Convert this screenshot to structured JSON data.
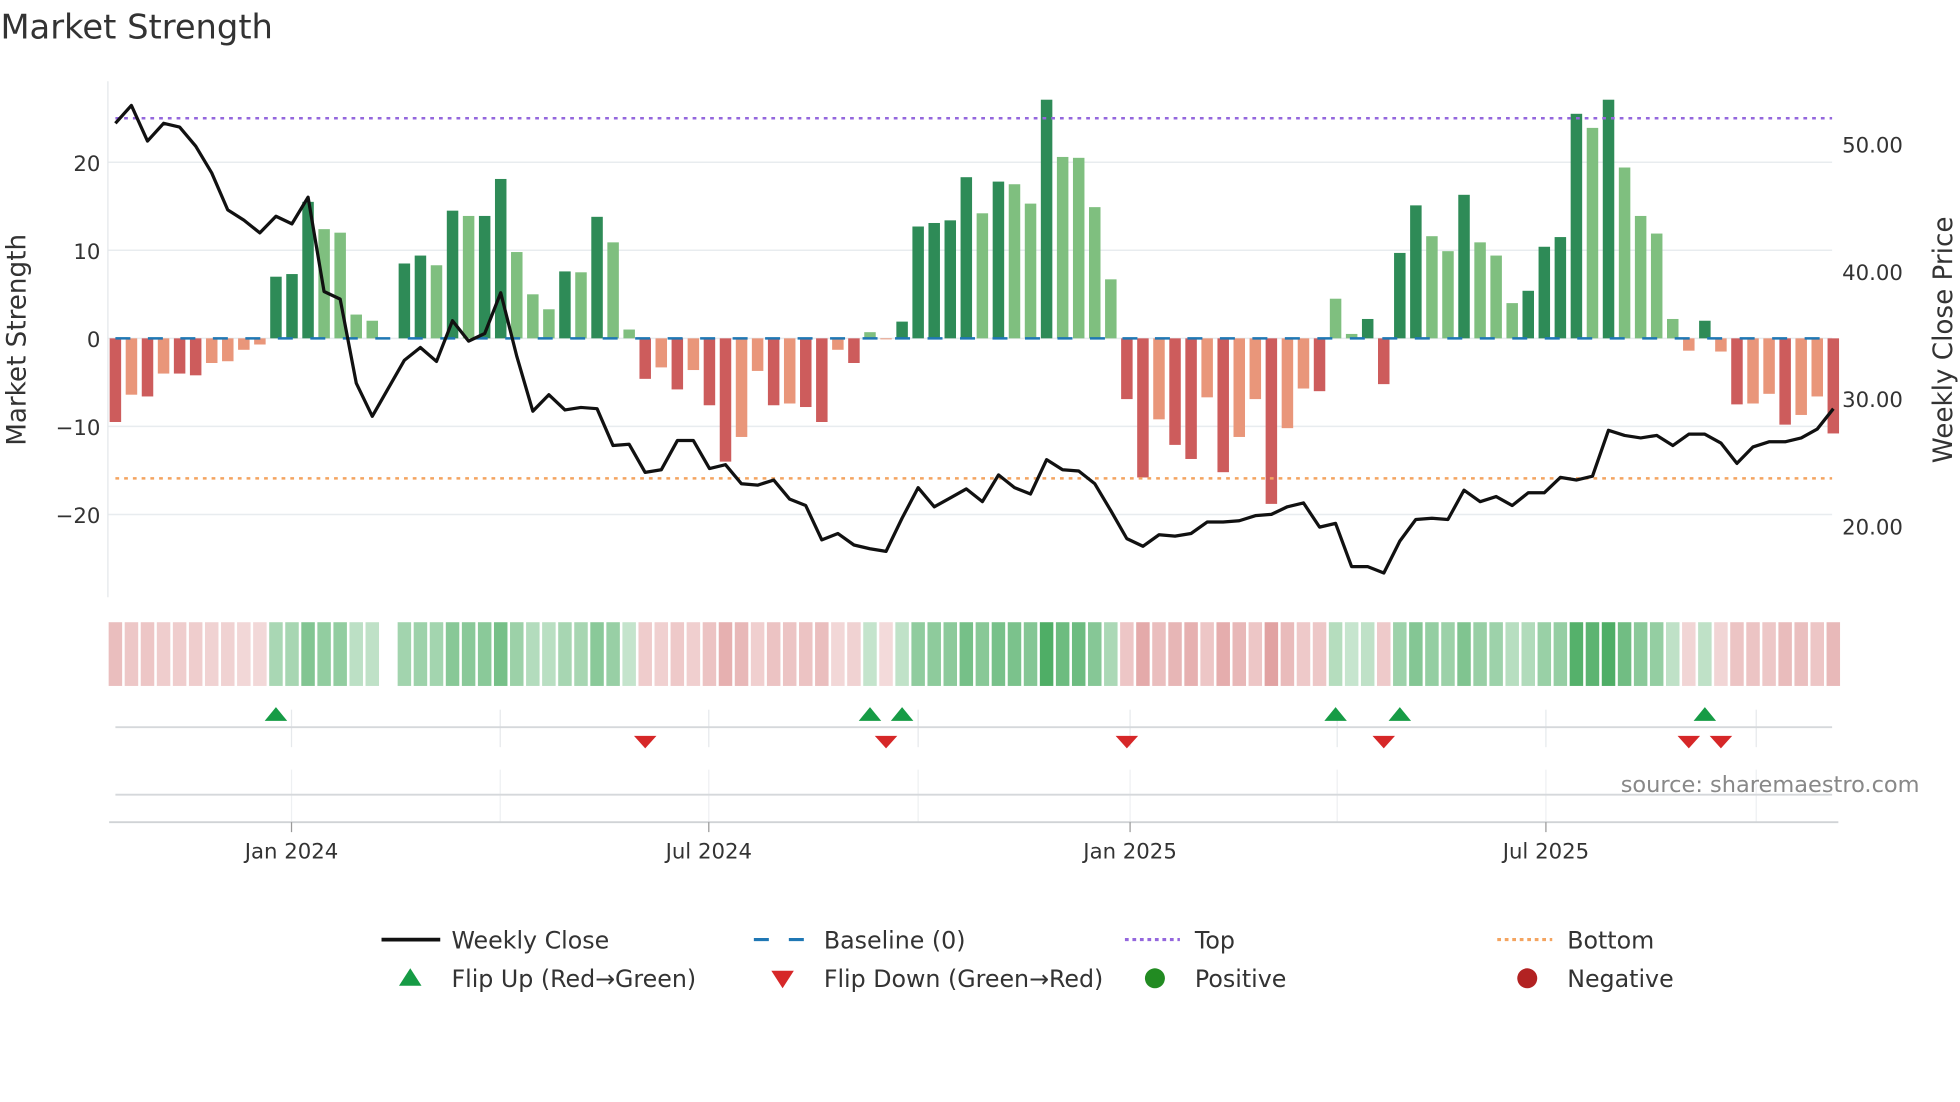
{
  "title": "Market Strength",
  "source": "source: sharemaestro.com",
  "colors": {
    "pos_strong": "#2e8b57",
    "pos_weak": "#7fbf7f",
    "neg_strong": "#cd5c5c",
    "neg_weak": "#e9967a",
    "close": "#111111",
    "baseline": "#1f77b4",
    "top": "#9467dd",
    "bottom": "#f4a460",
    "flip_up": "#169b45",
    "flip_down": "#d62728",
    "positive": "#228b22",
    "negative": "#b22222"
  },
  "chart_data": {
    "type": "bar",
    "title": "Market Strength",
    "ylabel": "Market Strength",
    "y2label": "Weekly Close Price",
    "ylim": [
      -29.4,
      29.2
    ],
    "y2lim": [
      14.4,
      54.9
    ],
    "yticks": [
      {
        "v": 20,
        "label": "20"
      },
      {
        "v": 10,
        "label": "10"
      },
      {
        "v": 0,
        "label": "0"
      },
      {
        "v": -10,
        "label": "−10"
      },
      {
        "v": -20,
        "label": "−20"
      }
    ],
    "y2ticks": [
      {
        "v": 50,
        "label": "50.00"
      },
      {
        "v": 40,
        "label": "40.00"
      },
      {
        "v": 30,
        "label": "30.00"
      },
      {
        "v": 20,
        "label": "20.00"
      }
    ],
    "xticks": [
      {
        "week": 10.97,
        "label": "Jan 2024"
      },
      {
        "week": 36.96,
        "label": "Jul 2024"
      },
      {
        "week": 63.2,
        "label": "Jan 2025"
      },
      {
        "week": 89.1,
        "label": "Jul 2025"
      }
    ],
    "quarter_grid_weeks": [
      10.97,
      23.97,
      36.96,
      50.0,
      63.2,
      76.1,
      89.1,
      102.2
    ],
    "top_level": 25.0,
    "bottom_level": -15.9,
    "strength": [
      -9.5,
      -6.4,
      -6.6,
      -4.0,
      -4.0,
      -4.2,
      -2.8,
      -2.6,
      -1.3,
      -0.7,
      7.0,
      7.3,
      15.5,
      12.4,
      12.0,
      2.7,
      2.0,
      null,
      8.5,
      9.4,
      8.3,
      14.5,
      13.9,
      13.9,
      18.1,
      9.8,
      5.0,
      3.3,
      7.6,
      7.5,
      13.8,
      10.9,
      1.0,
      -4.6,
      -3.3,
      -5.8,
      -3.6,
      -7.6,
      -14.0,
      -11.2,
      -3.7,
      -7.6,
      -7.4,
      -7.8,
      -9.5,
      -1.3,
      -2.8,
      0.7,
      -0.1,
      1.9,
      12.7,
      13.1,
      13.4,
      18.3,
      14.2,
      17.8,
      17.5,
      15.3,
      27.1,
      20.6,
      20.5,
      14.9,
      6.7,
      -6.9,
      -15.8,
      -9.2,
      -12.1,
      -13.7,
      -6.7,
      -15.2,
      -11.2,
      -6.9,
      -18.8,
      -10.2,
      -5.7,
      -6.0,
      4.5,
      0.5,
      2.2,
      -5.2,
      9.7,
      15.1,
      11.6,
      9.9,
      16.3,
      10.9,
      9.4,
      4.0,
      5.4,
      10.4,
      11.5,
      25.5,
      23.9,
      27.1,
      19.4,
      13.9,
      11.9,
      2.2,
      -1.4,
      2.0,
      -1.5,
      -7.5,
      -7.4,
      -6.3,
      -9.8,
      -8.7,
      -6.6,
      -10.8
    ],
    "weekly_close": [
      51.6,
      53.0,
      50.2,
      51.6,
      51.3,
      49.8,
      47.7,
      44.8,
      44.0,
      43.0,
      44.3,
      43.7,
      45.8,
      38.4,
      37.8,
      31.2,
      28.6,
      30.8,
      33.0,
      34.0,
      32.9,
      36.1,
      34.5,
      35.1,
      38.3,
      33.3,
      29.0,
      30.3,
      29.1,
      29.3,
      29.2,
      26.3,
      26.4,
      24.2,
      24.4,
      26.7,
      26.7,
      24.5,
      24.8,
      23.3,
      23.2,
      23.6,
      22.1,
      21.6,
      18.9,
      19.4,
      18.5,
      18.2,
      18.0,
      20.6,
      23.0,
      21.5,
      22.2,
      22.9,
      21.9,
      24.0,
      23.0,
      22.5,
      25.2,
      24.4,
      24.3,
      23.3,
      21.2,
      19.0,
      18.4,
      19.3,
      19.2,
      19.4,
      20.3,
      20.3,
      20.4,
      20.8,
      20.9,
      21.5,
      21.8,
      19.9,
      20.2,
      16.8,
      16.8,
      16.3,
      18.8,
      20.5,
      20.6,
      20.5,
      22.8,
      21.9,
      22.3,
      21.6,
      22.6,
      22.6,
      23.8,
      23.6,
      23.9,
      27.5,
      27.1,
      26.9,
      27.1,
      26.3,
      27.2,
      27.2,
      26.5,
      24.9,
      26.2,
      26.6,
      26.6,
      26.9,
      27.6,
      29.2
    ],
    "legend": [
      {
        "key": "close",
        "label": "Weekly Close",
        "kind": "line"
      },
      {
        "key": "baseline",
        "label": "Baseline (0)",
        "kind": "dash"
      },
      {
        "key": "top",
        "label": "Top",
        "kind": "dot"
      },
      {
        "key": "bottom",
        "label": "Bottom",
        "kind": "dot"
      },
      {
        "key": "flip_up",
        "label": "Flip Up (Red→Green)",
        "kind": "up"
      },
      {
        "key": "flip_down",
        "label": "Flip Down (Green→Red)",
        "kind": "down"
      },
      {
        "key": "positive",
        "label": "Positive",
        "kind": "circle"
      },
      {
        "key": "negative",
        "label": "Negative",
        "kind": "circle"
      }
    ],
    "legend_placement": "bottom"
  }
}
